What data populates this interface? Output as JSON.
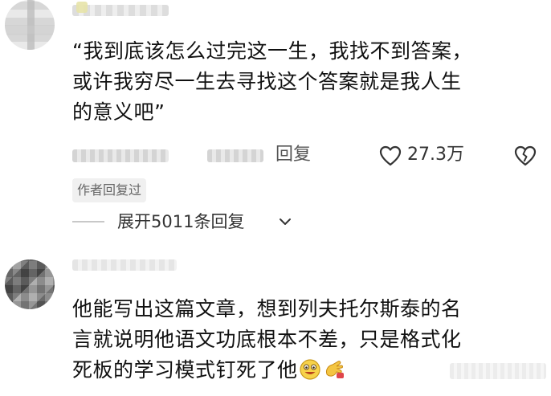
{
  "comments": [
    {
      "text_lines": [
        "“我到底该怎么过完这一生，我找不到答案，",
        "或许我穷尽一生去寻找这个答案就是我人生",
        "的意义吧”"
      ],
      "reply_label": "回复",
      "like_count": "27.3万",
      "author_badge": "作者回复过",
      "expand_label": "展开5011条回复"
    },
    {
      "text_lines": [
        "他能写出这篇文章，想到列夫托尔斯泰的名",
        "言就说明他语文功底根本不差，只是格式化",
        "死板的学习模式钉死了他"
      ]
    }
  ],
  "icons": {
    "like": "heart-outline-icon",
    "dislike": "broken-heart-icon",
    "expand": "chevron-down-icon",
    "emoji_1": "grinning-face-icon",
    "emoji_2": "clapping-hand-icon"
  },
  "colors": {
    "text": "#111111",
    "meta": "#555555",
    "badge_bg": "#f0f0f0",
    "badge_text": "#666666"
  }
}
